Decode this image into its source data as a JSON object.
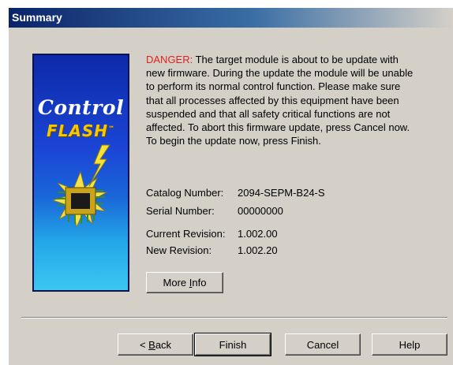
{
  "window": {
    "title": "Summary"
  },
  "logo": {
    "line1": "Control",
    "line2": "FLASH",
    "trademark": "™"
  },
  "message": {
    "danger_label": "DANGER:",
    "body": " The target module is about to be update with new firmware. During the update the module will be unable to perform its normal control function. Please make sure that all processes affected by this equipment have been suspended and that all safety critical functions are not affected. To abort this firmware update, press Cancel now. To begin the update now, press Finish."
  },
  "device": {
    "catalog_label": "Catalog Number:",
    "catalog_value": "2094-SEPM-B24-S",
    "serial_label": "Serial Number:",
    "serial_value": "00000000",
    "current_label": "Current Revision:",
    "current_value": "1.002.00",
    "new_label": "New Revision:",
    "new_value": "1.002.20"
  },
  "buttons": {
    "more_info_pre": "More ",
    "more_info_accel": "I",
    "more_info_post": "nfo",
    "back_pre": "< ",
    "back_accel": "B",
    "back_post": "ack",
    "finish": "Finish",
    "cancel": "Cancel",
    "help": "Help"
  },
  "colors": {
    "danger": "#e02020",
    "dialog_bg": "#d4d0c8",
    "title_bar": "#0a246a"
  }
}
